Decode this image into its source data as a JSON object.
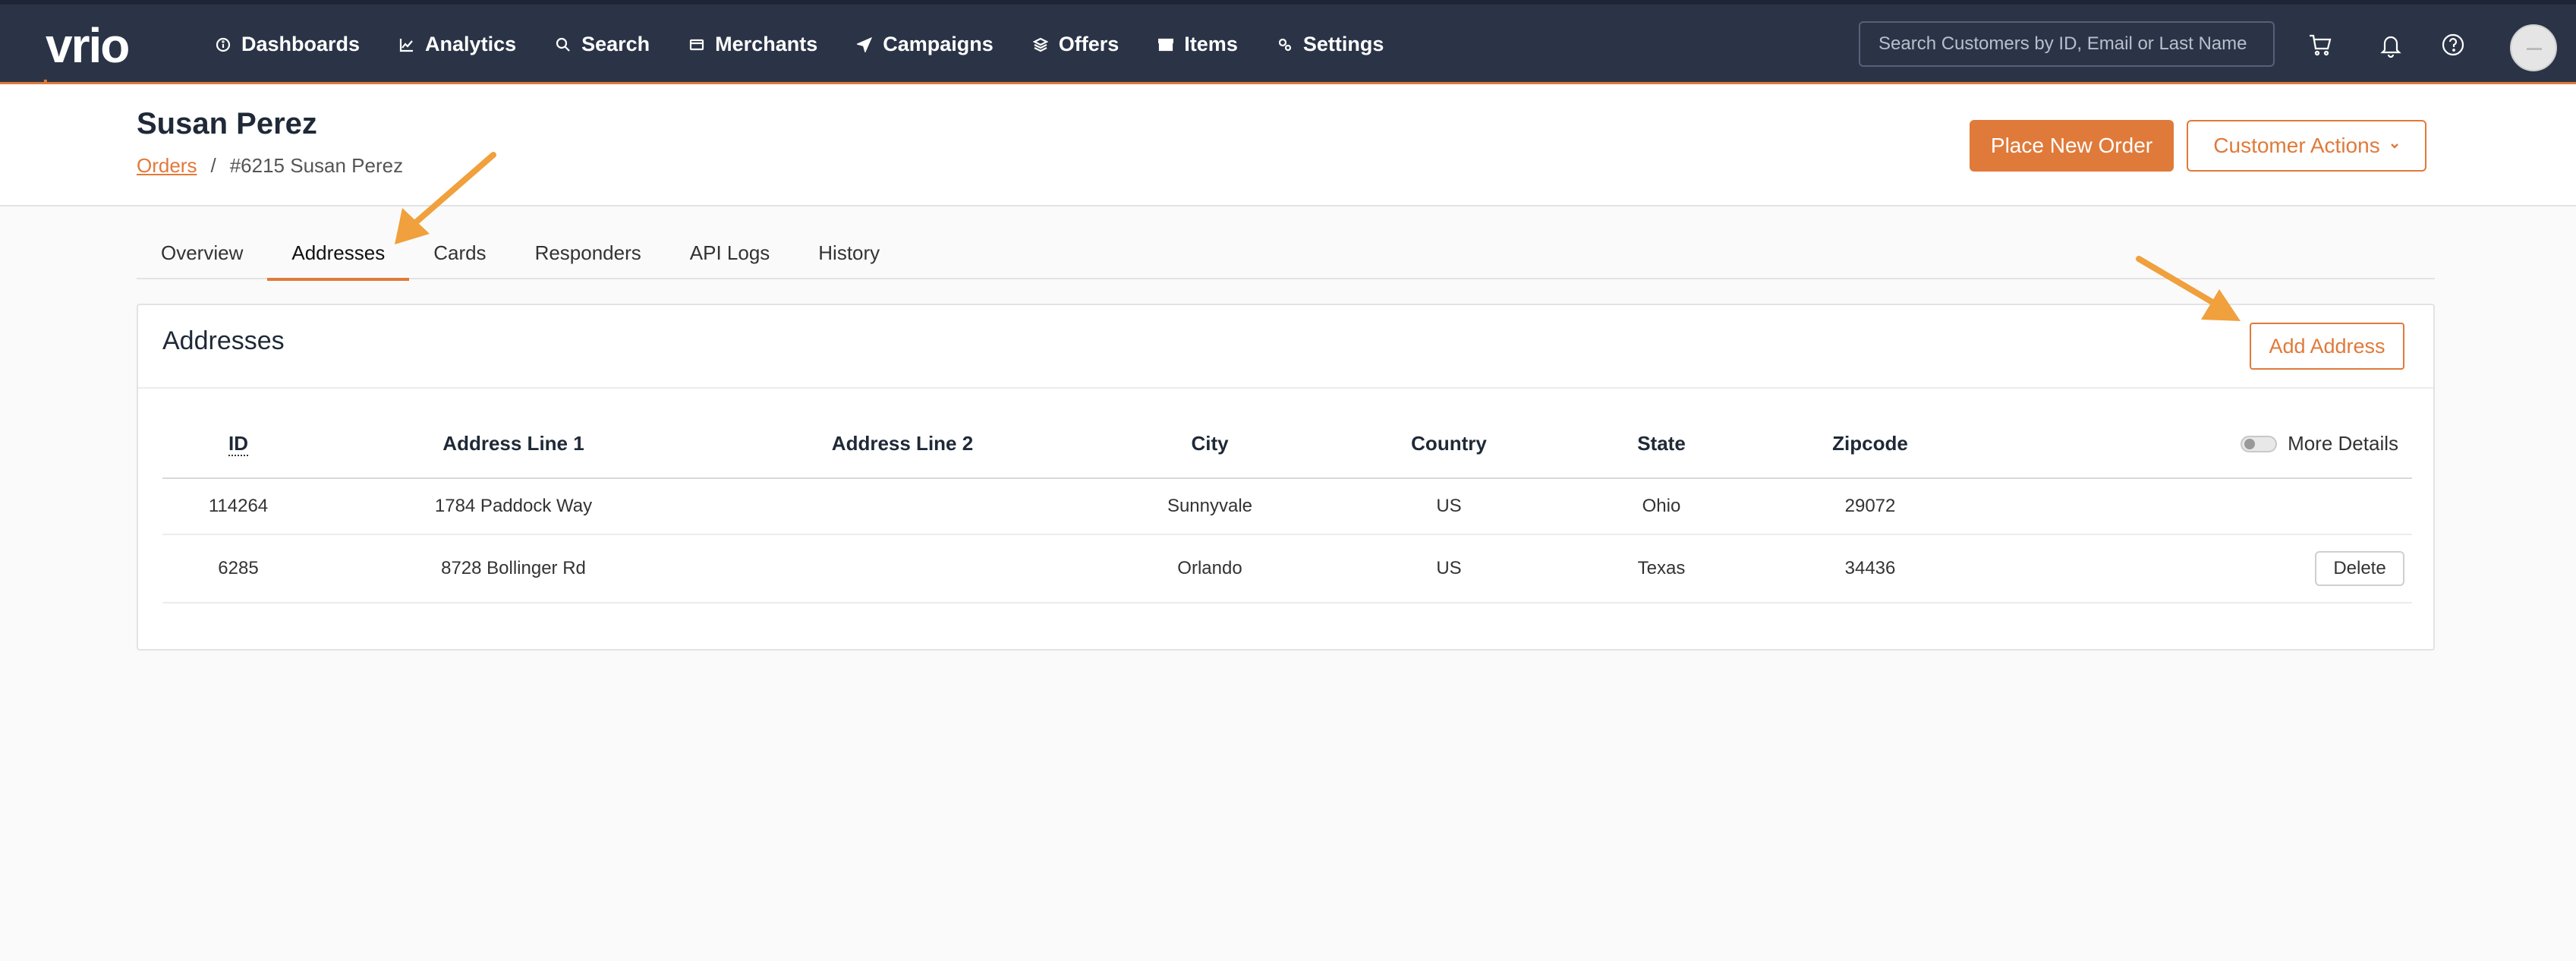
{
  "app": {
    "logo_text": "vrio"
  },
  "nav": {
    "items": [
      {
        "label": "Dashboards",
        "icon": "info-circle-icon"
      },
      {
        "label": "Analytics",
        "icon": "line-chart-icon"
      },
      {
        "label": "Search",
        "icon": "search-icon"
      },
      {
        "label": "Merchants",
        "icon": "card-icon"
      },
      {
        "label": "Campaigns",
        "icon": "paper-plane-icon"
      },
      {
        "label": "Offers",
        "icon": "layers-icon"
      },
      {
        "label": "Items",
        "icon": "box-icon"
      },
      {
        "label": "Settings",
        "icon": "gears-icon"
      }
    ],
    "active": "Settings",
    "search_placeholder": "Search Customers by ID, Email or Last Name"
  },
  "header": {
    "title": "Susan Perez",
    "breadcrumb_link": "Orders",
    "breadcrumb_sep": "/",
    "breadcrumb_current": "#6215 Susan Perez",
    "place_order_label": "Place New Order",
    "customer_actions_label": "Customer Actions"
  },
  "tabs": {
    "items": [
      "Overview",
      "Addresses",
      "Cards",
      "Responders",
      "API Logs",
      "History"
    ],
    "active": "Addresses"
  },
  "addresses": {
    "title": "Addresses",
    "add_label": "Add Address",
    "columns": [
      "ID",
      "Address Line 1",
      "Address Line 2",
      "City",
      "Country",
      "State",
      "Zipcode"
    ],
    "more_details_label": "More Details",
    "rows": [
      {
        "id": "114264",
        "line1": "1784 Paddock Way",
        "line2": "",
        "city": "Sunnyvale",
        "country": "US",
        "state": "Ohio",
        "zipcode": "29072",
        "delete_label": ""
      },
      {
        "id": "6285",
        "line1": "8728 Bollinger Rd",
        "line2": "",
        "city": "Orlando",
        "country": "US",
        "state": "Texas",
        "zipcode": "34436",
        "delete_label": "Delete"
      }
    ]
  },
  "colors": {
    "accent": "#e07a3a",
    "nav_bg": "#2b3447",
    "annotation_arrow": "#f0a03c"
  }
}
